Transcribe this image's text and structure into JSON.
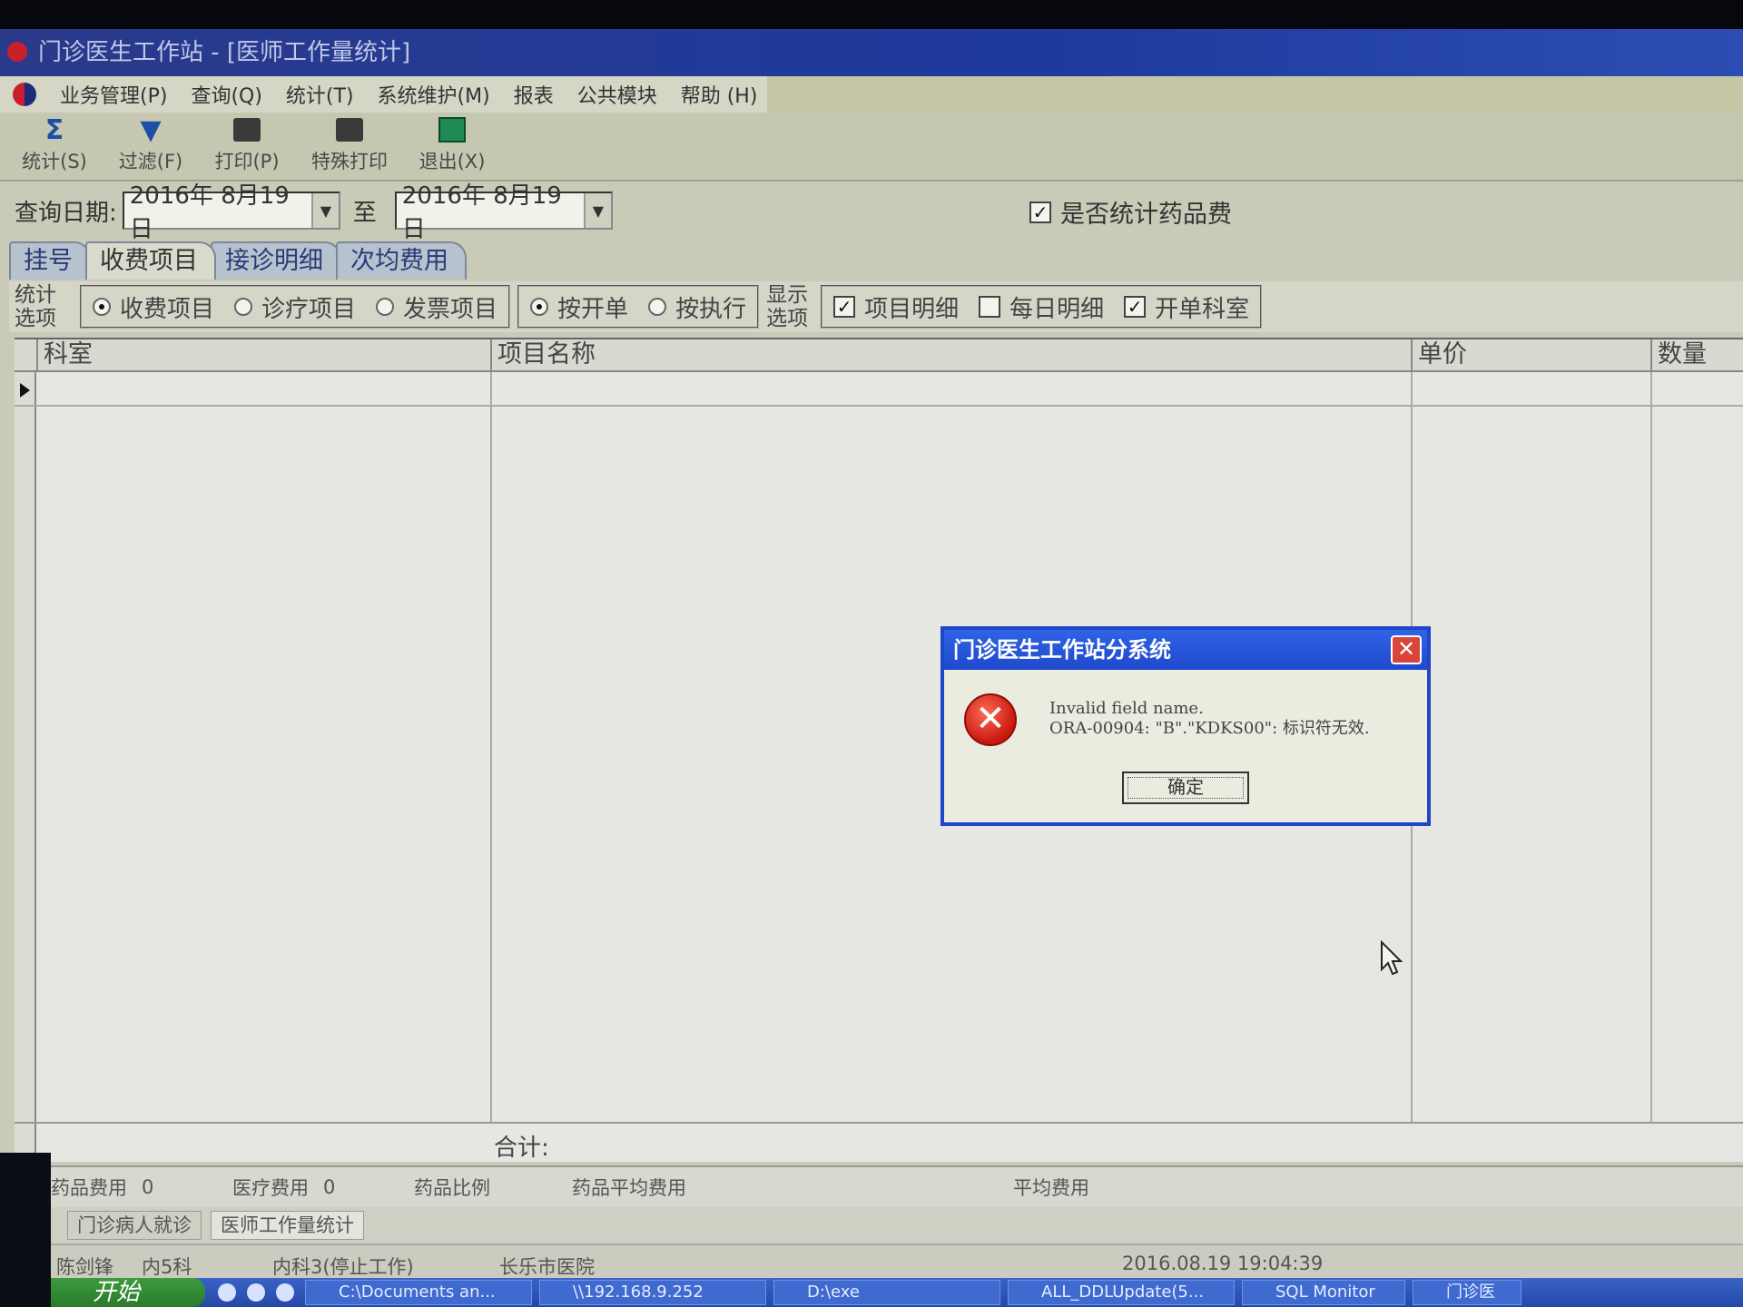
{
  "window": {
    "title": "门诊医生工作站 - [医师工作量统计]"
  },
  "menu": {
    "items": [
      "业务管理(P)",
      "查询(Q)",
      "统计(T)",
      "系统维护(M)",
      "报表",
      "公共模块",
      "帮助 (H)"
    ]
  },
  "toolbar": {
    "stats_label": "统计(S)",
    "filter_label": "过滤(F)",
    "print_label": "打印(P)",
    "special_print_label": "特殊打印",
    "exit_label": "退出(X)"
  },
  "query": {
    "date_label": "查询日期:",
    "from_date": "2016年 8月19日",
    "to_label": "至",
    "to_date": "2016年 8月19日",
    "drug_fee_label": "是否统计药品费",
    "drug_fee_checked": true
  },
  "tabs": [
    "挂号",
    "收费项目",
    "接诊明细",
    "次均费用"
  ],
  "options": {
    "stat_label_1": "统计",
    "stat_label_2": "选项",
    "radio_charge": "收费项目",
    "radio_treatment": "诊疗项目",
    "radio_invoice": "发票项目",
    "radio_by_order": "按开单",
    "radio_by_exec": "按执行",
    "display_label_1": "显示",
    "display_label_2": "选项",
    "chk_item_detail": "项目明细",
    "chk_daily_detail": "每日明细",
    "chk_dept": "开单科室"
  },
  "grid": {
    "columns": [
      "科室",
      "项目名称",
      "单价",
      "数量"
    ],
    "total_label": "合计:"
  },
  "summary": {
    "drug_fee_label": "药品费用",
    "drug_fee_value": "0",
    "medical_fee_label": "医疗费用",
    "medical_fee_value": "0",
    "drug_ratio_label": "药品比例",
    "drug_avg_label": "药品平均费用",
    "avg_fee_label": "平均费用"
  },
  "window_tabs": [
    "门诊病人就诊",
    "医师工作量统计"
  ],
  "status": {
    "user": "陈剑锋",
    "dept": "内5科",
    "ward": "内科3(停止工作)",
    "hospital": "长乐市医院",
    "datetime": "2016.08.19 19:04:39"
  },
  "taskbar": {
    "start_label": "开始",
    "tasks": [
      "C:\\Documents an...",
      "\\\\192.168.9.252",
      "D:\\exe",
      "ALL_DDLUpdate(5...",
      "SQL Monitor",
      "门诊医"
    ]
  },
  "dialog": {
    "title": "门诊医生工作站分系统",
    "close_label": "✕",
    "message_line1": "Invalid field name.",
    "message_line2": "ORA-00904: \"B\".\"KDKS00\": 标识符无效.",
    "ok_label": "确定"
  }
}
